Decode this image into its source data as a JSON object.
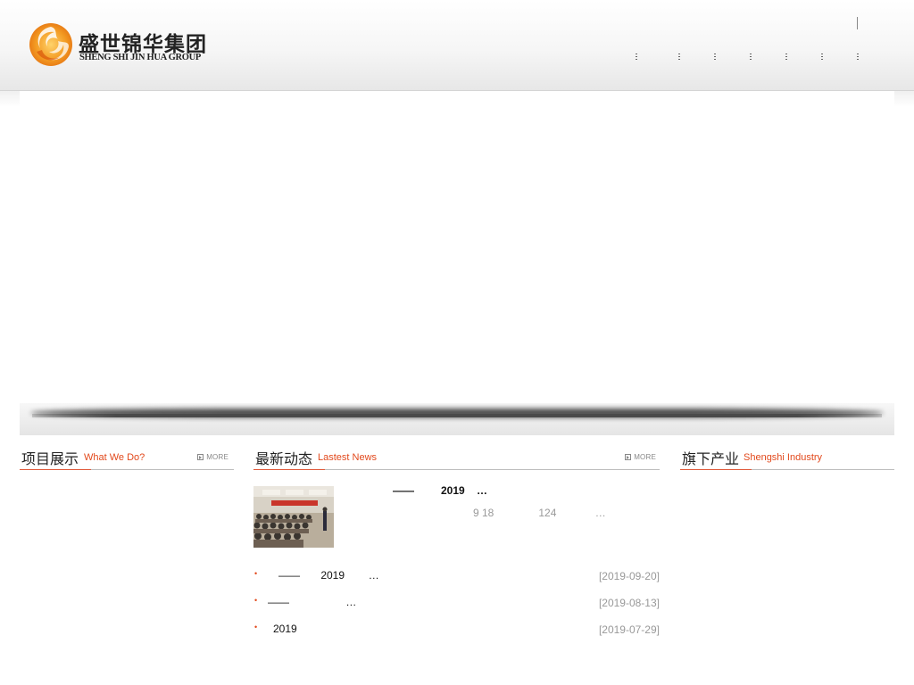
{
  "logo": {
    "cn": "盛世锦华集团",
    "en": "SHENG SHI JIN HUA GROUP"
  },
  "sections": {
    "projects": {
      "cn": "项目展示",
      "en": "What We Do?",
      "more": "MORE"
    },
    "news": {
      "cn": "最新动态",
      "en": "Lastest News",
      "more": "MORE",
      "featured": {
        "title": "——         2019    …",
        "desc": "9 18               124             …"
      },
      "items": [
        {
          "text": "——       2019        …",
          "date": "[2019-09-20]"
        },
        {
          "text": "——                   …",
          "date": "[2019-08-13]"
        },
        {
          "text": "2019",
          "date": "[2019-07-29]"
        }
      ]
    },
    "industry": {
      "cn": "旗下产业",
      "en": "Shengshi Industry"
    }
  },
  "colors": {
    "accent": "#e2481b",
    "logo_orange": "#f08a1c",
    "text": "#222222",
    "muted": "#999999"
  }
}
